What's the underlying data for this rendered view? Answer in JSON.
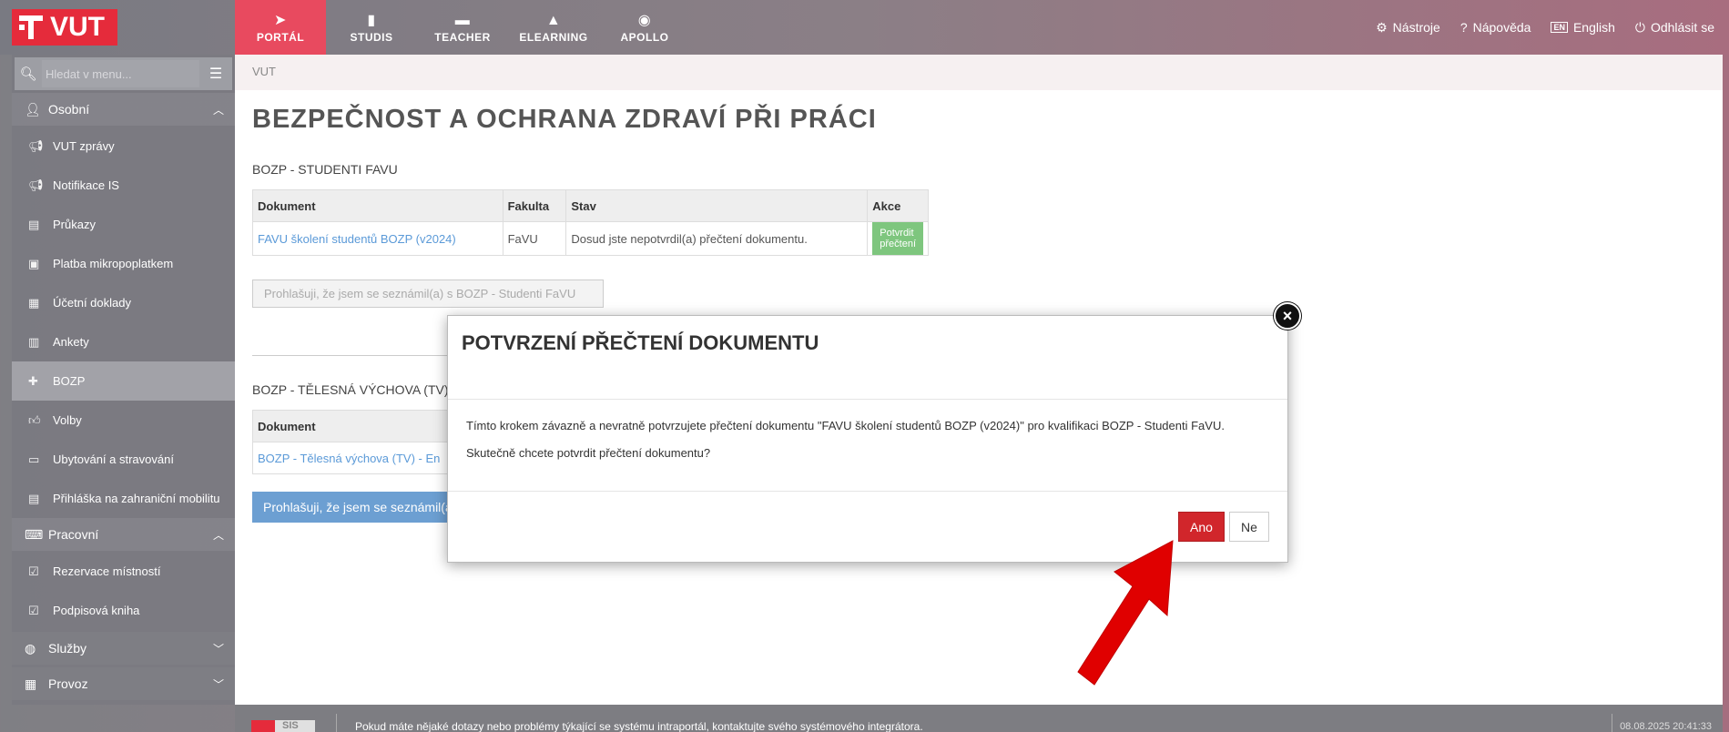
{
  "logo": {
    "text": "VUT"
  },
  "topnav": [
    {
      "label": "PORTÁL",
      "icon": "➤"
    },
    {
      "label": "STUDIS",
      "icon": "▮"
    },
    {
      "label": "TEACHER",
      "icon": "▬"
    },
    {
      "label": "ELEARNING",
      "icon": "▲"
    },
    {
      "label": "APOLLO",
      "icon": "◉"
    }
  ],
  "toolbar": {
    "tools": "Nástroje",
    "help": "Nápověda",
    "lang_badge": "EN",
    "lang": "English",
    "logout": "Odhlásit se"
  },
  "search": {
    "placeholder": "Hledat v menu..."
  },
  "sidebar": {
    "group_personal": "Osobní",
    "items_personal": [
      "VUT zprávy",
      "Notifikace IS",
      "Průkazy",
      "Platba mikropoplatkem",
      "Účetní doklady",
      "Ankety",
      "BOZP",
      "Volby",
      "Ubytování a stravování",
      "Přihláška na zahraniční mobilitu"
    ],
    "group_work": "Pracovní",
    "items_work": [
      "Rezervace místností",
      "Podpisová kniha"
    ],
    "group_services": "Služby",
    "group_operations": "Provoz"
  },
  "breadcrumb": "VUT",
  "page_title": "BEZPEČNOST A OCHRANA ZDRAVÍ PŘI PRÁCI",
  "section1": {
    "title": "BOZP - STUDENTI FAVU",
    "headers": [
      "Dokument",
      "Fakulta",
      "Stav",
      "Akce"
    ],
    "row": {
      "doc": "FAVU školení studentů BOZP (v2024)",
      "faculty": "FaVU",
      "status": "Dosud jste nepotvrdil(a) přečtení dokumentu.",
      "action": "Potvrdit přečtení"
    },
    "declare": "Prohlašuji, že jsem se seznámil(a) s BOZP - Studenti FaVU"
  },
  "section2": {
    "title": "BOZP - TĚLESNÁ VÝCHOVA (TV)",
    "header": "Dokument",
    "row_doc": "BOZP - Tělesná výchova (TV) - En",
    "declare": "Prohlašuji, že jsem se seznámil(a"
  },
  "modal": {
    "title": "POTVRZENÍ PŘEČTENÍ DOKUMENTU",
    "text1": "Tímto krokem závazně a nevratně potvrzujete přečtení dokumentu \"FAVU školení studentů BOZP (v2024)\" pro kvalifikaci BOZP - Studenti FaVU.",
    "text2": "Skutečně chcete potvrdit přečtení dokumentu?",
    "yes": "Ano",
    "no": "Ne",
    "close": "×"
  },
  "footer": {
    "logo_text": "SIS",
    "text": "Pokud máte nějaké dotazy nebo problémy týkající se systému intraportál, kontaktujte svého systémového integrátora.",
    "time": "08.08.2025 20:41:33"
  },
  "colors": {
    "accent": "#e52b3b",
    "confirm": "#d1262b",
    "link": "#5b9ad8"
  }
}
